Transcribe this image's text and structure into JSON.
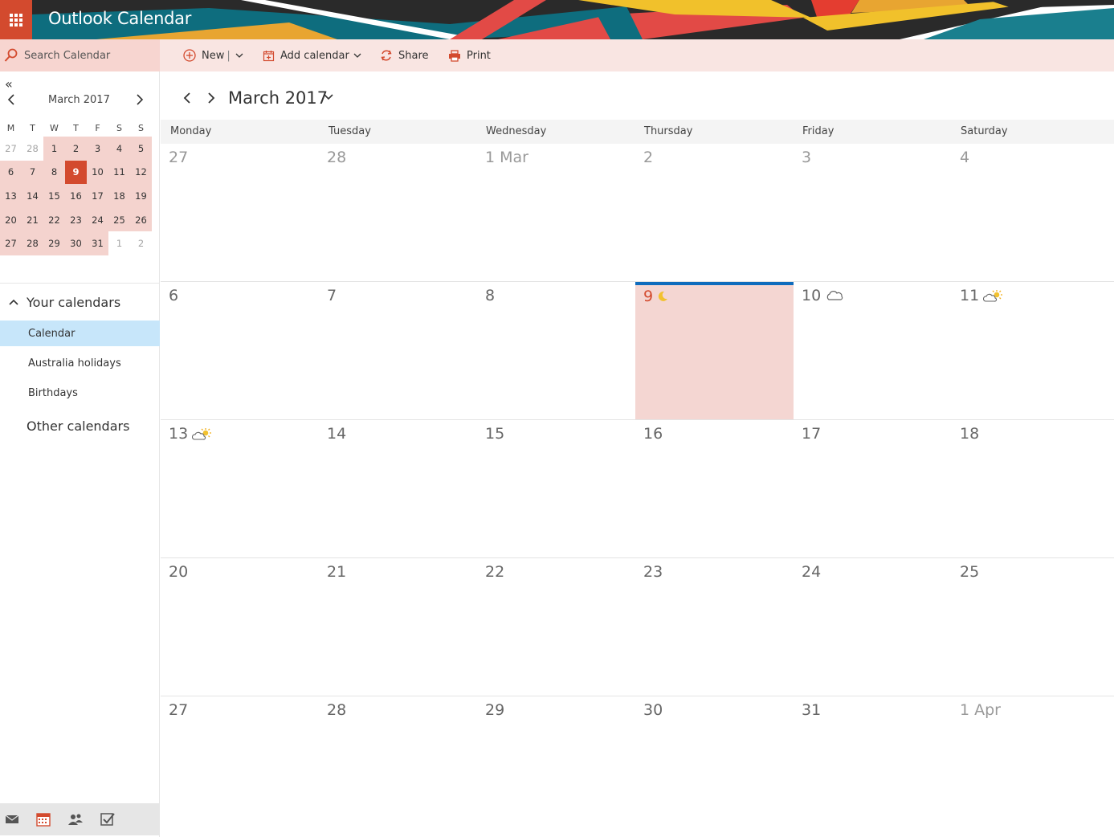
{
  "app": {
    "title": "Outlook Calendar"
  },
  "search": {
    "placeholder": "Search Calendar"
  },
  "toolbar": {
    "new_label": "New",
    "add_calendar_label": "Add calendar",
    "share_label": "Share",
    "print_label": "Print"
  },
  "mini_calendar": {
    "collapse_label": "«",
    "title": "March 2017",
    "dow": [
      "M",
      "T",
      "W",
      "T",
      "F",
      "S",
      "S"
    ],
    "weeks": [
      [
        {
          "d": "27",
          "s": "other"
        },
        {
          "d": "28",
          "s": "other"
        },
        {
          "d": "1",
          "s": "cur"
        },
        {
          "d": "2",
          "s": "cur"
        },
        {
          "d": "3",
          "s": "cur"
        },
        {
          "d": "4",
          "s": "cur"
        },
        {
          "d": "5",
          "s": "cur"
        }
      ],
      [
        {
          "d": "6",
          "s": "cur"
        },
        {
          "d": "7",
          "s": "cur"
        },
        {
          "d": "8",
          "s": "cur"
        },
        {
          "d": "9",
          "s": "today"
        },
        {
          "d": "10",
          "s": "cur"
        },
        {
          "d": "11",
          "s": "cur"
        },
        {
          "d": "12",
          "s": "cur"
        }
      ],
      [
        {
          "d": "13",
          "s": "cur"
        },
        {
          "d": "14",
          "s": "cur"
        },
        {
          "d": "15",
          "s": "cur"
        },
        {
          "d": "16",
          "s": "cur"
        },
        {
          "d": "17",
          "s": "cur"
        },
        {
          "d": "18",
          "s": "cur"
        },
        {
          "d": "19",
          "s": "cur"
        }
      ],
      [
        {
          "d": "20",
          "s": "cur"
        },
        {
          "d": "21",
          "s": "cur"
        },
        {
          "d": "22",
          "s": "cur"
        },
        {
          "d": "23",
          "s": "cur"
        },
        {
          "d": "24",
          "s": "cur"
        },
        {
          "d": "25",
          "s": "cur"
        },
        {
          "d": "26",
          "s": "cur"
        }
      ],
      [
        {
          "d": "27",
          "s": "cur"
        },
        {
          "d": "28",
          "s": "cur"
        },
        {
          "d": "29",
          "s": "cur"
        },
        {
          "d": "30",
          "s": "cur"
        },
        {
          "d": "31",
          "s": "cur"
        },
        {
          "d": "1",
          "s": "other"
        },
        {
          "d": "2",
          "s": "other"
        }
      ]
    ]
  },
  "calendars": {
    "section_label": "Your calendars",
    "items": [
      {
        "label": "Calendar",
        "selected": true
      },
      {
        "label": "Australia holidays",
        "selected": false
      },
      {
        "label": "Birthdays",
        "selected": false
      }
    ],
    "other_label": "Other calendars"
  },
  "main": {
    "month_title": "March 2017",
    "weekdays": [
      "Monday",
      "Tuesday",
      "Wednesday",
      "Thursday",
      "Friday",
      "Saturday"
    ],
    "weeks": [
      [
        {
          "n": "27",
          "dim": true
        },
        {
          "n": "28",
          "dim": true
        },
        {
          "n": "1 Mar",
          "dim": true
        },
        {
          "n": "2",
          "dim": true
        },
        {
          "n": "3",
          "dim": true
        },
        {
          "n": "4",
          "dim": true
        }
      ],
      [
        {
          "n": "6"
        },
        {
          "n": "7"
        },
        {
          "n": "8"
        },
        {
          "n": "9",
          "today": true,
          "weather": "moon-icon"
        },
        {
          "n": "10",
          "weather": "cloud-icon"
        },
        {
          "n": "11",
          "weather": "partly-sunny-icon"
        }
      ],
      [
        {
          "n": "13",
          "weather": "partly-sunny-icon"
        },
        {
          "n": "14"
        },
        {
          "n": "15"
        },
        {
          "n": "16"
        },
        {
          "n": "17"
        },
        {
          "n": "18"
        }
      ],
      [
        {
          "n": "20"
        },
        {
          "n": "21"
        },
        {
          "n": "22"
        },
        {
          "n": "23"
        },
        {
          "n": "24"
        },
        {
          "n": "25"
        }
      ],
      [
        {
          "n": "27"
        },
        {
          "n": "28"
        },
        {
          "n": "29"
        },
        {
          "n": "30"
        },
        {
          "n": "31"
        },
        {
          "n": "1 Apr",
          "dim": true
        }
      ]
    ]
  },
  "bottom_nav": [
    "mail-icon",
    "calendar-icon",
    "people-icon",
    "tasks-icon"
  ],
  "colors": {
    "accent": "#d34a2e",
    "today_fill": "#f4d6d2",
    "today_bar": "#0f6cbd",
    "selected_calendar": "#c7e6fa"
  }
}
